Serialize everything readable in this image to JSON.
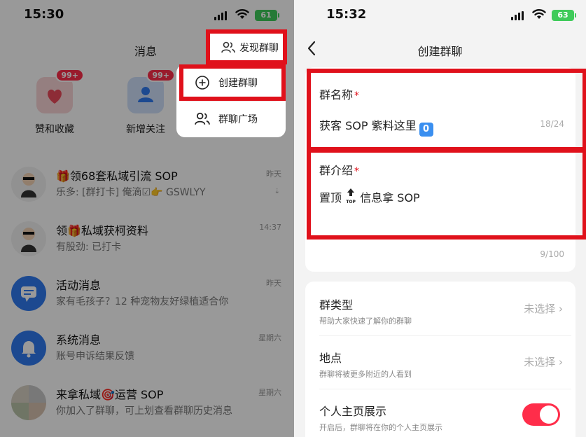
{
  "left": {
    "status": {
      "time": "15:30",
      "battery": "61"
    },
    "title": "消息",
    "discover_label": "发现群聊",
    "quick_actions": [
      {
        "label": "赞和收藏",
        "badge": "99+",
        "icon": "heart-icon",
        "color": "#f9d4d6"
      },
      {
        "label": "新增关注",
        "badge": "99+",
        "icon": "person-icon",
        "color": "#cfe0fb"
      }
    ],
    "popup": {
      "create_label": "创建群聊",
      "plaza_label": "群聊广场"
    },
    "chats": [
      {
        "name": "🎁领68套私域引流 SOP",
        "message": "乐多: [群打卡] 俺滴☑👉 GSWLYY",
        "time": "昨天",
        "pinned": true,
        "avatar": "cartoon-avatar-icon"
      },
      {
        "name": "领🎁私域获柯资料",
        "message": "有股劲: 已打卡",
        "time": "14:37",
        "pinned": false,
        "avatar": "cartoon-avatar-icon"
      },
      {
        "name": "活动消息",
        "message": "家有毛孩子？12 种宠物友好绿植适合你",
        "time": "昨天",
        "pinned": false,
        "avatar": "chat-bubble-icon"
      },
      {
        "name": "系统消息",
        "message": "账号申诉结果反馈",
        "time": "星期六",
        "pinned": false,
        "avatar": "bell-icon"
      },
      {
        "name": "来拿私域🎯运营 SOP",
        "message": "你加入了群聊，可上划查看群聊历史消息",
        "time": "星期六",
        "pinned": false,
        "avatar": "group-avatar-icon"
      }
    ],
    "colors": {
      "red_highlight": "#e0111b",
      "accent_blue": "#2f7bf0"
    }
  },
  "right": {
    "status": {
      "time": "15:32",
      "battery": "63"
    },
    "title": "创建群聊",
    "name_field": {
      "label": "群名称",
      "required_mark": "*",
      "value": "获客 SOP 紫料这里",
      "value_emoji": "0",
      "count": "18/24"
    },
    "intro_field": {
      "label": "群介绍",
      "required_mark": "*",
      "value_prefix": "置顶",
      "value_top_icon": "TOP",
      "value_suffix": "信息拿 SOP",
      "count": "9/100"
    },
    "settings": [
      {
        "title": "群类型",
        "subtitle": "帮助大家快速了解你的群聊",
        "value": "未选择"
      },
      {
        "title": "地点",
        "subtitle": "群聊将被更多附近的人看到",
        "value": "未选择"
      },
      {
        "title": "个人主页展示",
        "subtitle": "开启后，群聊将在你的个人主页展示",
        "toggle_on": true
      }
    ],
    "colors": {
      "toggle": "#ff2d4a"
    }
  }
}
